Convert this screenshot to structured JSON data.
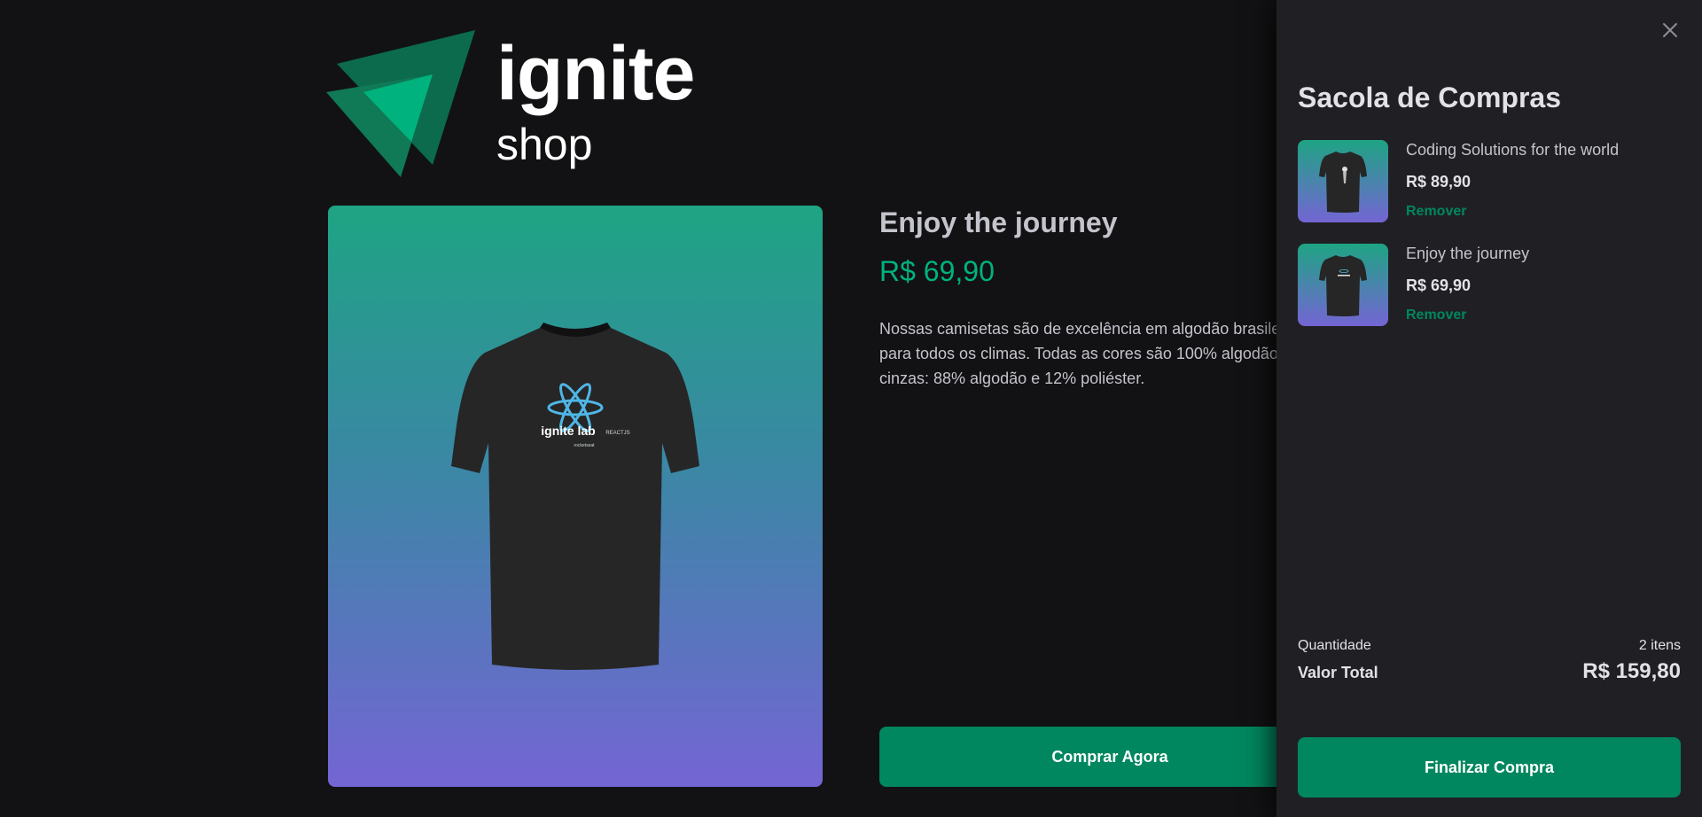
{
  "brand": {
    "word": "ignite",
    "sub": "shop",
    "colors": {
      "dark": "#0a5c42",
      "light": "#00b37e"
    }
  },
  "product": {
    "title": "Enjoy the journey",
    "price": "R$ 69,90",
    "description": "Nossas camisetas são de excelência em algodão brasileiro, para todos os climas. Todas as cores são 100% algodão, exceto cinzas: 88% algodão e 12% poliéster.",
    "description_lines": [
      "Nossas camisetas são de excelência em algodão brasile",
      "para todos os climas. Todas as cores são 100% algodão",
      "cinzas: 88% algodão e 12% poliéster."
    ],
    "buy_label": "Comprar Agora",
    "shirt_print": {
      "brand": "ignite lab",
      "tag": "REACTJS",
      "small": "rocketseat"
    },
    "image_gradient": [
      "#1ea483",
      "#7465d4"
    ]
  },
  "cart": {
    "title": "Sacola de Compras",
    "close_icon": "close-icon",
    "items": [
      {
        "name": "Coding Solutions for the world",
        "price": "R$ 89,90",
        "remove_label": "Remover"
      },
      {
        "name": "Enjoy the journey",
        "price": "R$ 69,90",
        "remove_label": "Remover"
      }
    ],
    "summary": {
      "quantity_label": "Quantidade",
      "quantity_value": "2 itens",
      "total_label": "Valor Total",
      "total_value": "R$ 159,80"
    },
    "checkout_label": "Finalizar Compra"
  },
  "colors": {
    "background": "#121214",
    "drawer": "#202024",
    "accent": "#00875f",
    "accent_light": "#00b37e"
  }
}
